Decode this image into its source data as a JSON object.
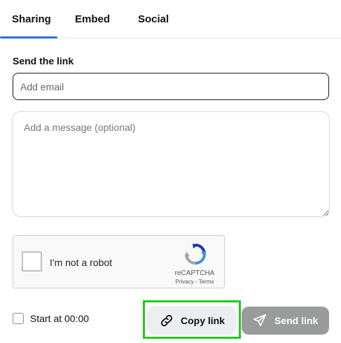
{
  "tabs": [
    {
      "label": "Sharing",
      "active": true
    },
    {
      "label": "Embed",
      "active": false
    },
    {
      "label": "Social",
      "active": false
    }
  ],
  "send": {
    "heading": "Send the link",
    "email_placeholder": "Add email",
    "message_placeholder": "Add a message (optional)"
  },
  "captcha": {
    "label": "I'm not a robot",
    "brand": "reCAPTCHA",
    "links": "Privacy - Terms"
  },
  "options": {
    "start_at_label": "Start at 00:00"
  },
  "actions": {
    "copy_label": "Copy link",
    "send_label": "Send link"
  },
  "colors": {
    "accent": "#2d6fd8",
    "highlight": "#22cc1a",
    "send_button": "#9a9b9d",
    "copy_button": "#eceef1"
  },
  "icons": {
    "copy": "link-icon",
    "send": "paper-plane-icon",
    "captcha": "recaptcha-logo-icon"
  }
}
